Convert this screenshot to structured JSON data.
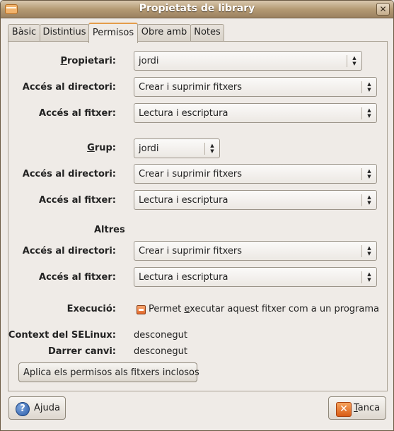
{
  "window": {
    "title": "Propietats de library"
  },
  "tabs": [
    {
      "label": "Bàsic",
      "active": false
    },
    {
      "label": "Distintius",
      "active": false
    },
    {
      "label": "Permisos",
      "active": true
    },
    {
      "label": "Obre amb",
      "active": false
    },
    {
      "label": "Notes",
      "active": false
    }
  ],
  "owner": {
    "label_mnemonic": "P",
    "label_rest": "ropietari:",
    "value": "jordi",
    "dir_access_label": "Accés al directori:",
    "dir_access_value": "Crear i suprimir fitxers",
    "file_access_label": "Accés al fitxer:",
    "file_access_value": "Lectura i escriptura"
  },
  "group": {
    "label_mnemonic": "G",
    "label_rest": "rup:",
    "value": "jordi",
    "dir_access_label": "Accés al directori:",
    "dir_access_value": "Crear i suprimir fitxers",
    "file_access_label": "Accés al fitxer:",
    "file_access_value": "Lectura i escriptura"
  },
  "others": {
    "title": "Altres",
    "dir_access_label": "Accés al directori:",
    "dir_access_value": "Crear i suprimir fitxers",
    "file_access_label": "Accés al fitxer:",
    "file_access_value": "Lectura i escriptura"
  },
  "execution": {
    "label": "Execució:",
    "checkbox_text_pre": "Permet ",
    "checkbox_text_mnemonic": "e",
    "checkbox_text_post": "xecutar aquest fitxer com a un programa",
    "state": "mixed"
  },
  "selinux": {
    "label": "Context del SELinux:",
    "value": "desconegut"
  },
  "last_change": {
    "label": "Darrer canvi:",
    "value": "desconegut"
  },
  "apply_button": "Aplica els permisos als fitxers inclosos",
  "footer": {
    "help_label": "Ajuda",
    "close_mnemonic": "T",
    "close_rest": "anca"
  }
}
